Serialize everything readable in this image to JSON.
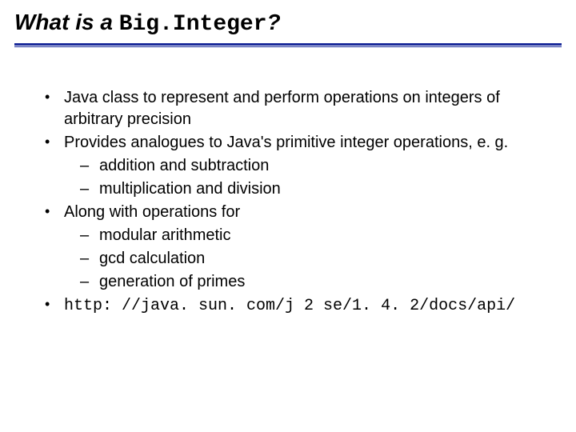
{
  "title": {
    "prefix": "What is a ",
    "mono": "Big.Integer",
    "suffix": "?"
  },
  "bullets": [
    {
      "text": "Java class to represent and perform operations on integers of arbitrary precision",
      "mono": false
    },
    {
      "text": "Provides analogues to Java's primitive integer operations, e. g.",
      "mono": false,
      "sub": [
        "addition and subtraction",
        "multiplication and division"
      ]
    },
    {
      "text": "Along with operations for",
      "mono": false,
      "sub": [
        "modular arithmetic",
        "gcd calculation",
        "generation of primes"
      ]
    },
    {
      "text": "http: //java. sun. com/j 2 se/1. 4. 2/docs/api/",
      "mono": true
    }
  ]
}
